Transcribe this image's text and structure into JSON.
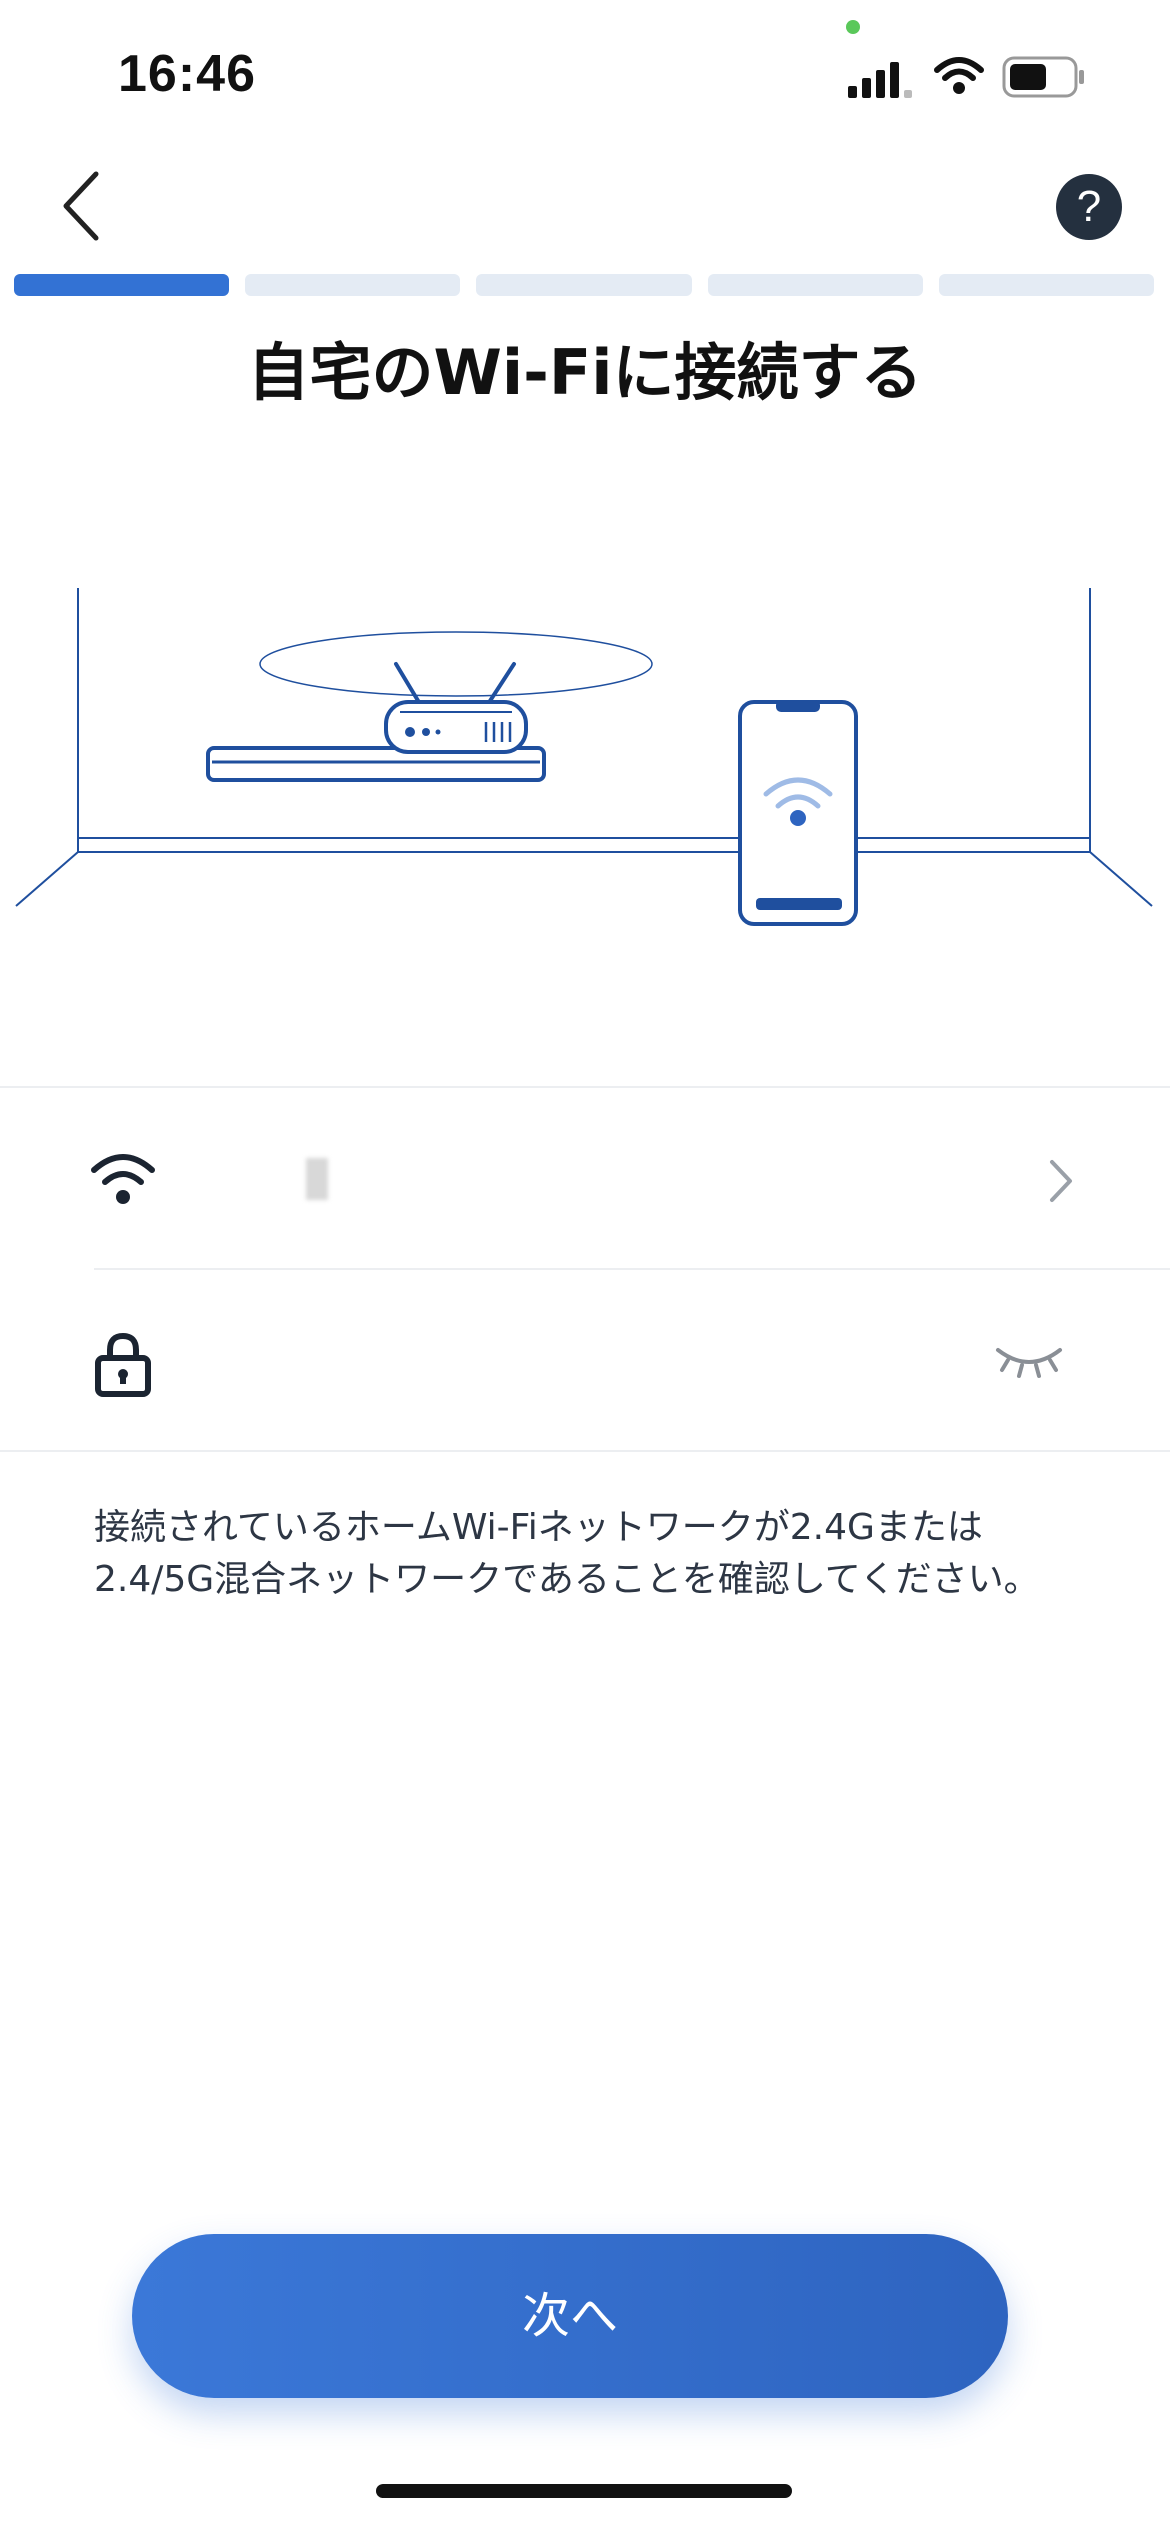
{
  "status_bar": {
    "time": "16:46",
    "icons": [
      "cellular-signal-icon",
      "wifi-icon",
      "battery-icon"
    ]
  },
  "nav": {
    "back_icon": "chevron-left-icon",
    "help_label": "?"
  },
  "progress": {
    "total_steps": 5,
    "current_step": 1
  },
  "title": "自宅のWi-Fiに接続する",
  "illustration": {
    "depicts": [
      "router-icon",
      "smartphone-icon",
      "wifi-icon"
    ]
  },
  "form": {
    "network_row": {
      "icon": "wifi-icon",
      "value": "",
      "trailing_icon": "chevron-right-icon"
    },
    "password_row": {
      "icon": "lock-icon",
      "value": "",
      "trailing_icon": "eye-closed-icon"
    }
  },
  "description": "接続されているホームWi-Fiネットワークが2.4Gまたは2.4/5G混合ネットワークであることを確認してください。",
  "next_button": {
    "label": "次へ"
  },
  "colors": {
    "accent": "#3372d4",
    "progress_inactive": "#e4ebf4",
    "illustration_line": "#1f4f9e",
    "help_bg": "#24303f"
  }
}
